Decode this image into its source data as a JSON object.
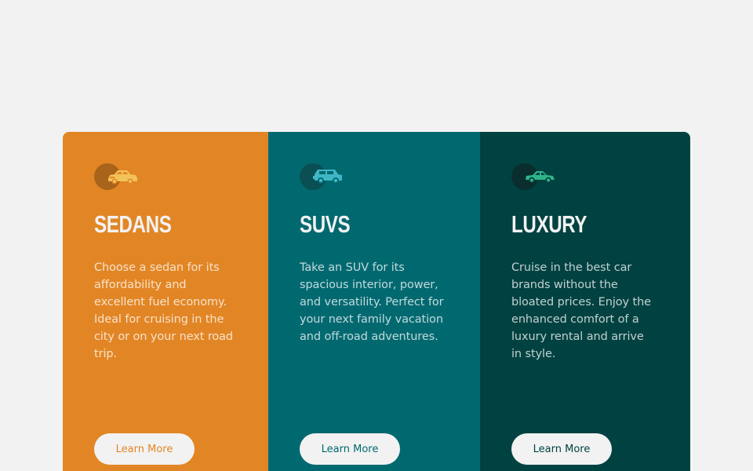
{
  "cards": [
    {
      "key": "sedans",
      "icon": "sedan-car-icon",
      "title": "Sedans",
      "description": "Choose a sedan for its affordability and excellent fuel economy. Ideal for cruising in the city or on your next road trip.",
      "button_label": "Learn More",
      "color": "#e28625"
    },
    {
      "key": "suvs",
      "icon": "suv-car-icon",
      "title": "SUVs",
      "description": "Take an SUV for its spacious interior, power, and versatility. Perfect for your next family vacation and off-road adventures.",
      "button_label": "Learn More",
      "color": "#006970"
    },
    {
      "key": "luxury",
      "icon": "luxury-car-icon",
      "title": "Luxury",
      "description": "Cruise in the best car brands without the bloated prices. Enjoy the enhanced comfort of a luxury rental and arrive in style.",
      "button_label": "Learn More",
      "color": "#004241"
    }
  ],
  "colors": {
    "background": "#f2f2f2",
    "icon_sedan": "#f3c15a",
    "icon_suv": "#3fb6c3",
    "icon_luxury": "#2fb58a"
  }
}
